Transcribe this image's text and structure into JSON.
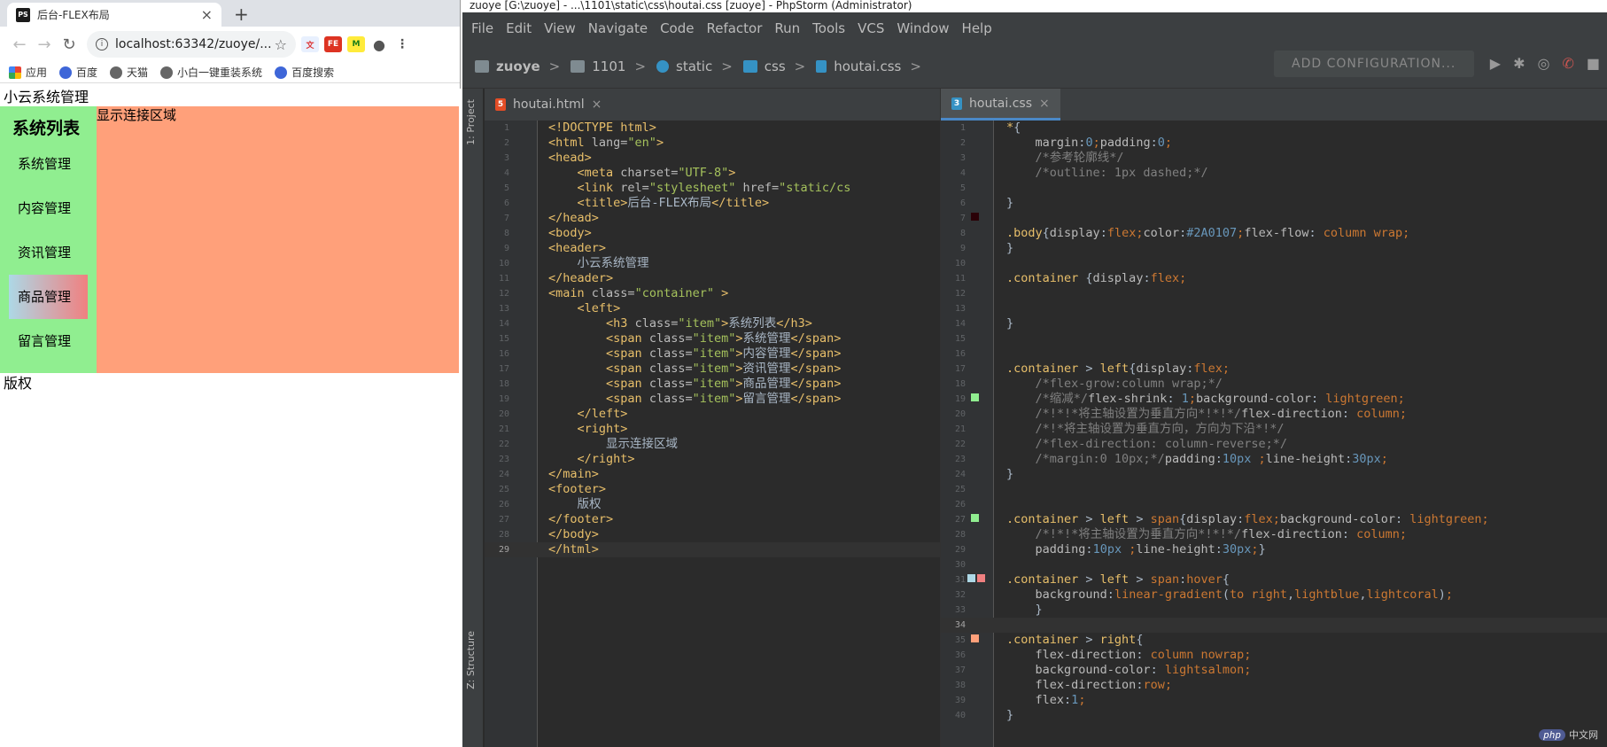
{
  "browser": {
    "tab_title": "后台-FLEX布局",
    "tab_favicon": "PS",
    "url": "localhost:63342/zuoye/...",
    "bookmarks": [
      {
        "label": "应用",
        "icon": "apps-grid-icon"
      },
      {
        "label": "百度",
        "icon": "baidu-paw-icon"
      },
      {
        "label": "天猫",
        "icon": "globe-icon"
      },
      {
        "label": "小白一键重装系统",
        "icon": "globe-icon"
      },
      {
        "label": "百度搜索",
        "icon": "baidu-paw-icon"
      }
    ],
    "page": {
      "header": "小云系统管理",
      "left_title": "系统列表",
      "left_items": [
        "系统管理",
        "内容管理",
        "资讯管理",
        "商品管理",
        "留言管理"
      ],
      "hovered_item_index": 3,
      "right_text": "显示连接区域",
      "footer": "版权"
    },
    "colors": {
      "left_bg": "#90ee90",
      "right_bg": "#ffa07a"
    }
  },
  "ide": {
    "title": "zuoye [G:\\zuoye] - ...\\1101\\static\\css\\houtai.css [zuoye] - PhpStorm (Administrator)",
    "menu": [
      "File",
      "Edit",
      "View",
      "Navigate",
      "Code",
      "Refactor",
      "Run",
      "Tools",
      "VCS",
      "Window",
      "Help"
    ],
    "breadcrumbs": [
      "zuoye",
      "1101",
      "static",
      "css",
      "houtai.css"
    ],
    "run_config": "ADD CONFIGURATION...",
    "side_labels": {
      "project": "1: Project",
      "structure": "Z: Structure"
    },
    "left_tab": "houtai.html",
    "right_tab": "houtai.css",
    "watermark": "中文网",
    "watermark_badge": "php"
  }
}
